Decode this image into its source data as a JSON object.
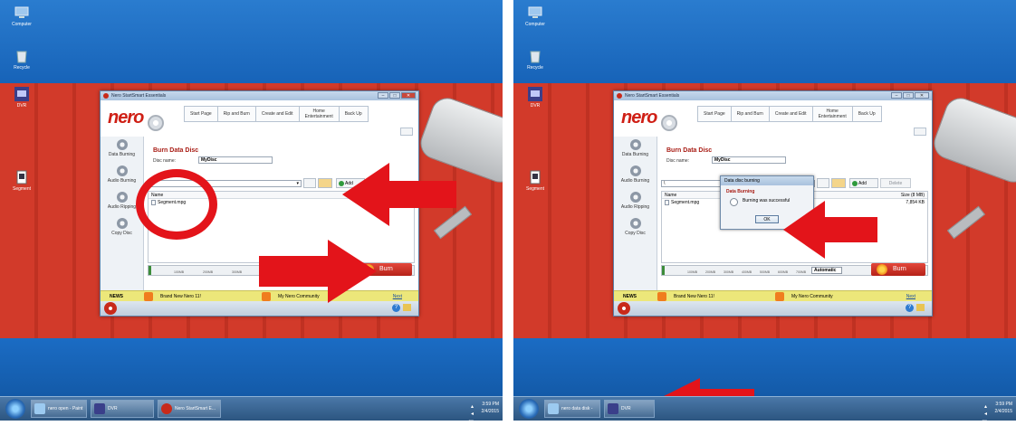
{
  "colors": {
    "annotation_red": "#e3141a",
    "nero_red": "#cf1f15",
    "desktop_blue": "#1a5fae"
  },
  "desktop": {
    "icons": [
      {
        "label": "Computer",
        "icon": "computer-icon"
      },
      {
        "label": "Recycle",
        "icon": "recycle-bin-icon"
      },
      {
        "label": "DVR",
        "icon": "dvr-icon"
      },
      {
        "label": "Segment",
        "icon": "file-icon"
      }
    ]
  },
  "nero": {
    "window_title": "Nero StartSmart Essentials",
    "logo": "nero",
    "tabs": [
      "Start Page",
      "Rip and Burn",
      "Create and Edit",
      "Home\nEntertainment",
      "Back Up"
    ],
    "sidebar": [
      "Data Burning",
      "Audio Burning",
      "Audio Ripping",
      "Copy Disc"
    ],
    "heading": "Burn Data Disc",
    "disc_name_label": "Disc name:",
    "disc_name_value": "MyDisc",
    "path": "\\",
    "add_label": "Add",
    "delete_label": "Delete",
    "col_name": "Name",
    "col_size_left": "",
    "col_size_right": "Size (8 MB)",
    "file_name": "Segment.mpg",
    "file_size": "7,854 KB",
    "capacity_ticks": [
      "100MB",
      "200MB",
      "300MB",
      "400MB",
      "500MB",
      "600MB",
      "700MB"
    ],
    "automatic_label": "Automatic",
    "burn_label": "Burn",
    "news_label": "NEWS",
    "news_item_1": "Brand New Nero 11!",
    "news_item_2": "My Nero Community",
    "next_label": "Next"
  },
  "dialog": {
    "title": "Data disc burning",
    "heading": "Data Burning",
    "message": "Burning was successful",
    "ok_label": "OK"
  },
  "taskbar_left": {
    "items": [
      "nero open - Paint",
      "DVR",
      "Nero StartSmart E..."
    ],
    "time": "3:59 PM",
    "date": "2/4/2015"
  },
  "taskbar_right": {
    "items": [
      "nero data disk - P...",
      "DVR"
    ],
    "time": "3:59 PM",
    "date": "2/4/2015"
  }
}
